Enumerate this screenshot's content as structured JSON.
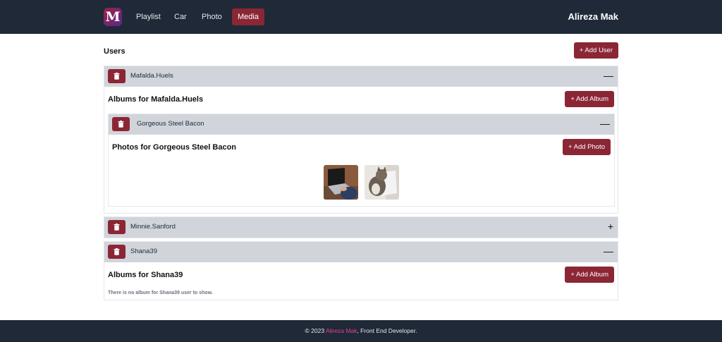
{
  "nav": {
    "logo_letter": "M",
    "links": [
      {
        "label": "Playlist",
        "active": false
      },
      {
        "label": "Car",
        "active": false
      },
      {
        "label": "Photo",
        "active": false
      },
      {
        "label": "Media",
        "active": true
      }
    ],
    "brand_name": "Alireza Mak"
  },
  "users": {
    "title": "Users",
    "add_label": "+ Add User",
    "items": [
      {
        "name": "Mafalda.Huels",
        "expanded": true,
        "toggle": "—",
        "albums_title": "Albums for Mafalda.Huels",
        "add_album_label": "+ Add Album",
        "albums": [
          {
            "name": "Gorgeous Steel Bacon",
            "expanded": true,
            "toggle": "—",
            "photos_title": "Photos for Gorgeous Steel Bacon",
            "add_photo_label": "+ Add Photo",
            "photos": [
              "laptop-photo",
              "cat-photo"
            ]
          }
        ]
      },
      {
        "name": "Minnie.Sanford",
        "expanded": false,
        "toggle": "+"
      },
      {
        "name": "Shana39",
        "expanded": true,
        "toggle": "—",
        "albums_title": "Albums for Shana39",
        "add_album_label": "+ Add Album",
        "empty_message": "There is no album for Shana39 user to show."
      }
    ]
  },
  "footer": {
    "prefix": "© 2023 ",
    "name": "Alireza Mak",
    "suffix": ", Front End Developer."
  },
  "colors": {
    "navbar_bg": "#1f2937",
    "accent": "#8b2635",
    "accordion_header": "#d1d5db",
    "footer_highlight": "#e0409a"
  }
}
